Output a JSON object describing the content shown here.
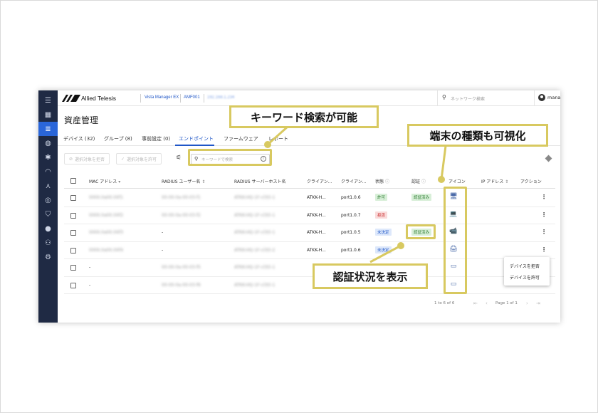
{
  "header": {
    "brand_name": "Allied Telesis",
    "product_name": "Vista Manager EX",
    "device_name": "AMF001",
    "device_ip": "192.168.1.234",
    "network_search_placeholder": "ネットワーク検索",
    "user_name": "manager"
  },
  "rail": {
    "icons": [
      "menu-icon",
      "dashboard-icon",
      "list-icon",
      "globe-icon",
      "alert-icon",
      "wifi-icon",
      "topology-icon",
      "radar-icon",
      "shield-icon",
      "cloud-icon",
      "users-icon",
      "settings-icon"
    ],
    "active_index": 2,
    "active_color": "#2a66d9"
  },
  "page": {
    "title": "資産管理"
  },
  "tabs": [
    "デバイス (32)",
    "グループ (8)",
    "事前設定 (0)",
    "エンドポイント",
    "ファームウェア",
    "レポート"
  ],
  "active_tab": "エンドポイント",
  "toolbar": {
    "deny_selected_label": "選択対象を拒否",
    "allow_selected_label": "選択対象を許可",
    "keyword_search_placeholder": "キーワードで検索"
  },
  "table": {
    "headers": {
      "mac": "MAC アドレス",
      "radius_user": "RADIUS ユーザー名",
      "radius_host": "RADIUS サーバーホスト名",
      "client1": "クライアン...",
      "client2": "クライアン...",
      "state": "状態",
      "auth": "認証",
      "icon": "アイコン",
      "ip": "IP アドレス",
      "action": "アクション"
    },
    "rows": [
      {
        "mac": "0000.0a00.0Xf1",
        "user": "00-00-0a-00-03-f1",
        "host": "ATKK-HQ-1F-cl3O-1",
        "c1": "ATKK-H...",
        "c2": "port1.0.6",
        "state": "許可",
        "state_kind": "allow",
        "auth": "認証済み",
        "icon": "desktop-pc-icon"
      },
      {
        "mac": "0000.0a00.0Xf2",
        "user": "00-00-0a-00-03-f2",
        "host": "ATKK-HQ-1F-cl3O-1",
        "c1": "ATKK-H...",
        "c2": "port1.0.7",
        "state": "拒否",
        "state_kind": "deny",
        "auth": "",
        "icon": "laptop-icon"
      },
      {
        "mac": "0000.0a00.0Xf3",
        "user": "-",
        "host": "ATKK-HQ-1F-cl3O-1",
        "c1": "ATKK-H...",
        "c2": "port1.0.5",
        "state": "未決定",
        "state_kind": "pending",
        "auth": "認証済み",
        "icon": "security-camera-icon"
      },
      {
        "mac": "0000.0a00.0Xf4",
        "user": "-",
        "host": "ATKK-HQ-1F-cl3O-2",
        "c1": "ATKK-H...",
        "c2": "port1.0.6",
        "state": "未決定",
        "state_kind": "pending",
        "auth": "",
        "icon": "printer-icon"
      },
      {
        "mac": "-",
        "user": "00-00-0a-00-03-f5",
        "host": "ATKK-HQ-1F-cl3O-1",
        "c1": "",
        "c2": "",
        "state": "",
        "state_kind": "",
        "auth": "",
        "icon": "network-device-icon"
      },
      {
        "mac": "-",
        "user": "00-00-0a-00-03-f6",
        "host": "ATKK-HQ-1F-cl3O-1",
        "c1": "",
        "c2": "",
        "state": "",
        "state_kind": "",
        "auth": "",
        "icon": "network-device-icon"
      }
    ]
  },
  "context_menu": {
    "deny_label": "デバイスを拒否",
    "allow_label": "デバイスを許可"
  },
  "pagination": {
    "range_text": "1 to 6 of 6",
    "page_text": "Page 1 of 1"
  },
  "callouts": {
    "keyword": "キーワード検索が可能",
    "device_type": "端末の種類も可視化",
    "auth_status": "認証状況を表示"
  },
  "colors": {
    "rail_bg": "#1f2a44",
    "accent": "#1f56c7",
    "callout_border": "#d8c960"
  }
}
